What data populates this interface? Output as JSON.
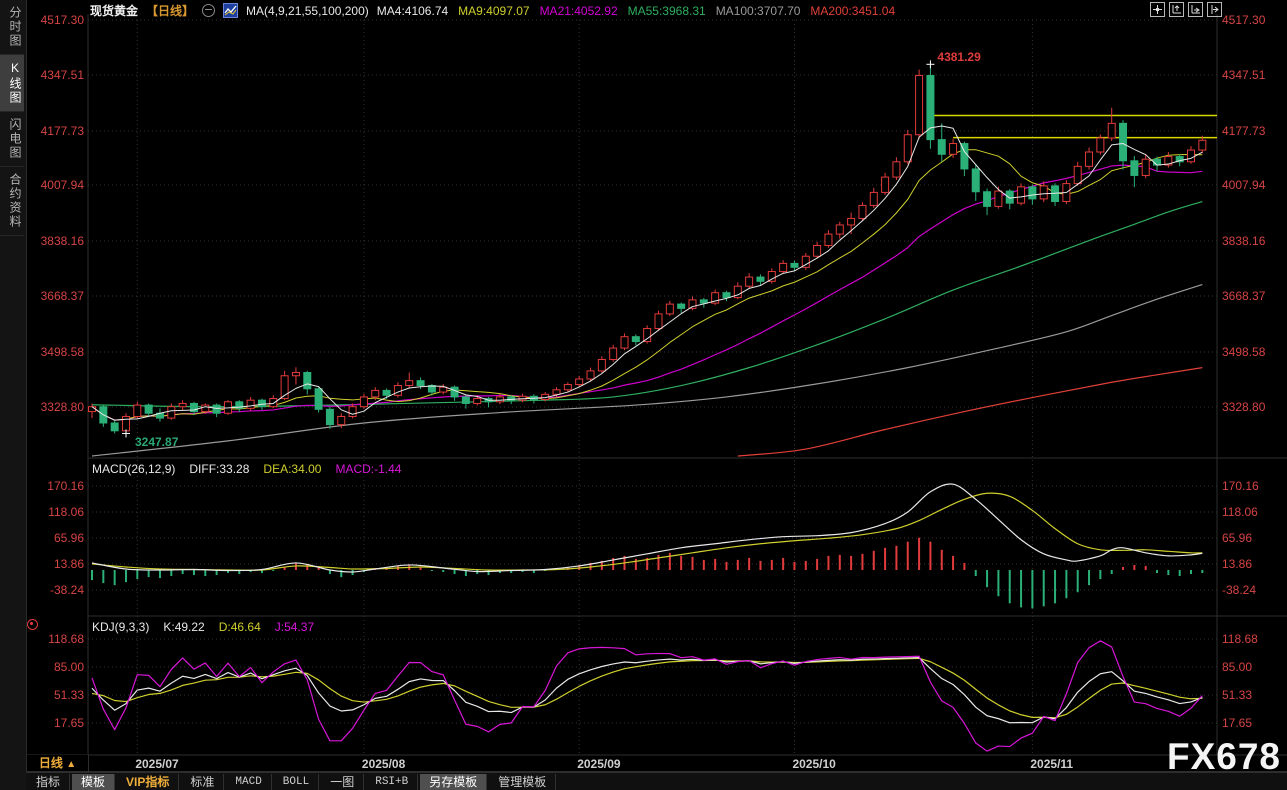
{
  "header": {
    "symbol": "现货黄金",
    "period_tag": "【日线】",
    "ma_group_label": "MA(4,9,21,55,100,200)",
    "ma_values": [
      {
        "text": "MA4:4106.74",
        "color": "#e8e8e8"
      },
      {
        "text": "MA9:4097.07",
        "color": "#cfcf2e"
      },
      {
        "text": "MA21:4052.92",
        "color": "#d400d4"
      },
      {
        "text": "MA55:3968.31",
        "color": "#2fae5f"
      },
      {
        "text": "MA100:3707.70",
        "color": "#9a9a9a"
      },
      {
        "text": "MA200:3451.04",
        "color": "#e04038"
      }
    ]
  },
  "sidebar": {
    "items": [
      {
        "label": "分时图",
        "active": false
      },
      {
        "label": "K线图",
        "active": true
      },
      {
        "label": "闪电图",
        "active": false
      },
      {
        "label": "合约资料",
        "active": false
      }
    ]
  },
  "main_axis": {
    "labels": [
      "4517.30",
      "4347.51",
      "4177.73",
      "4007.94",
      "3838.16",
      "3668.37",
      "3498.58",
      "3328.80"
    ]
  },
  "macd_panel": {
    "title": "MACD(26,12,9)",
    "values": [
      {
        "text": "DIFF:33.28",
        "color": "#e8e8e8"
      },
      {
        "text": "DEA:34.00",
        "color": "#cfcf2e"
      },
      {
        "text": "MACD:-1.44",
        "color": "#d816d8"
      }
    ],
    "axis_labels": [
      "170.16",
      "118.06",
      "65.96",
      "13.86",
      "-38.24"
    ]
  },
  "kdj_panel": {
    "title": "KDJ(9,3,3)",
    "values": [
      {
        "text": "K:49.22",
        "color": "#e8e8e8"
      },
      {
        "text": "D:46.64",
        "color": "#cfcf2e"
      },
      {
        "text": "J:54.37",
        "color": "#d816d8"
      }
    ],
    "axis_labels": [
      "118.68",
      "85.00",
      "51.33",
      "17.65"
    ]
  },
  "x_axis": {
    "labels": [
      "2025/07",
      "2025/08",
      "2025/09",
      "2025/10",
      "2025/11"
    ],
    "indices": [
      4,
      24,
      43,
      62,
      83
    ]
  },
  "annotations": {
    "high": {
      "value": "4381.29",
      "price": 4381.29,
      "index": 74
    },
    "low": {
      "value": "3247.87",
      "price": 3247.87,
      "index": 3
    }
  },
  "period_selector": {
    "label": "日线",
    "arrow": "▲"
  },
  "toolbar": {
    "items": [
      {
        "label": "指标"
      },
      {
        "label": "模板",
        "selected": true
      },
      {
        "label": "VIP指标",
        "accent": true
      },
      {
        "label": "标准"
      },
      {
        "label": "MACD",
        "mono": true
      },
      {
        "label": "BOLL",
        "mono": true
      },
      {
        "label": "一图"
      },
      {
        "label": "RSI+B",
        "mono": true
      },
      {
        "label": "另存模板",
        "selected": true
      },
      {
        "label": "管理模板"
      }
    ]
  },
  "watermark": "FX678",
  "colors": {
    "up": "#e23b3b",
    "down": "#2bb078",
    "ma4": "#e8e8e8",
    "ma9": "#cfcf2e",
    "ma21": "#cc00cc",
    "ma55": "#2fae5f",
    "ma100": "#9a9a9a",
    "ma200": "#e04038",
    "axis_text": "#d64444",
    "grid": "#333333",
    "separator": "#2e2e2e",
    "resistance": "#d8d800",
    "diff": "#e8e8e8",
    "dea": "#cfcf2e",
    "hist_up": "#e23b3b",
    "hist_down": "#2bb078",
    "k": "#e8e8e8",
    "d": "#cfcf2e",
    "j": "#d816d8",
    "high_label": "#e03c3c",
    "low_label": "#2aa876",
    "marker": "#ffffff"
  },
  "chart_data": {
    "type": "candlestick+indicators",
    "title": "现货黄金 日线",
    "price_axis_values": [
      4517.3,
      4347.51,
      4177.73,
      4007.94,
      3838.16,
      3668.37,
      3498.58,
      3328.8
    ],
    "resistance_lines": [
      {
        "price": 4224,
        "from_index": 74
      },
      {
        "price": 4156,
        "from_index": 76
      }
    ],
    "candles": [
      [
        3315,
        3340,
        3295,
        3330
      ],
      [
        3330,
        3335,
        3268,
        3280
      ],
      [
        3280,
        3290,
        3248,
        3256
      ],
      [
        3256,
        3310,
        3247.87,
        3300
      ],
      [
        3300,
        3345,
        3292,
        3335
      ],
      [
        3335,
        3340,
        3298,
        3310
      ],
      [
        3310,
        3325,
        3284,
        3295
      ],
      [
        3295,
        3340,
        3290,
        3330
      ],
      [
        3330,
        3350,
        3320,
        3340
      ],
      [
        3340,
        3345,
        3304,
        3315
      ],
      [
        3315,
        3340,
        3308,
        3335
      ],
      [
        3335,
        3340,
        3298,
        3310
      ],
      [
        3310,
        3350,
        3305,
        3345
      ],
      [
        3345,
        3350,
        3314,
        3325
      ],
      [
        3325,
        3360,
        3318,
        3350
      ],
      [
        3350,
        3355,
        3320,
        3330
      ],
      [
        3330,
        3365,
        3325,
        3355
      ],
      [
        3355,
        3440,
        3350,
        3425
      ],
      [
        3425,
        3451,
        3398,
        3435
      ],
      [
        3435,
        3440,
        3368,
        3385
      ],
      [
        3385,
        3390,
        3312,
        3322
      ],
      [
        3322,
        3330,
        3262,
        3275
      ],
      [
        3275,
        3310,
        3264,
        3300
      ],
      [
        3300,
        3340,
        3294,
        3330
      ],
      [
        3330,
        3370,
        3324,
        3360
      ],
      [
        3360,
        3390,
        3350,
        3380
      ],
      [
        3380,
        3386,
        3354,
        3365
      ],
      [
        3365,
        3405,
        3358,
        3395
      ],
      [
        3395,
        3435,
        3388,
        3410
      ],
      [
        3410,
        3420,
        3384,
        3395
      ],
      [
        3395,
        3400,
        3364,
        3375
      ],
      [
        3375,
        3400,
        3368,
        3390
      ],
      [
        3390,
        3395,
        3348,
        3360
      ],
      [
        3360,
        3365,
        3324,
        3340
      ],
      [
        3340,
        3365,
        3334,
        3355
      ],
      [
        3355,
        3360,
        3328,
        3345
      ],
      [
        3345,
        3370,
        3338,
        3360
      ],
      [
        3360,
        3366,
        3338,
        3350
      ],
      [
        3350,
        3370,
        3344,
        3362
      ],
      [
        3362,
        3368,
        3340,
        3352
      ],
      [
        3352,
        3375,
        3346,
        3368
      ],
      [
        3368,
        3390,
        3360,
        3382
      ],
      [
        3382,
        3405,
        3374,
        3398
      ],
      [
        3398,
        3425,
        3390,
        3415
      ],
      [
        3415,
        3450,
        3408,
        3440
      ],
      [
        3440,
        3485,
        3434,
        3475
      ],
      [
        3475,
        3520,
        3468,
        3510
      ],
      [
        3510,
        3555,
        3504,
        3545
      ],
      [
        3545,
        3552,
        3518,
        3530
      ],
      [
        3530,
        3580,
        3524,
        3570
      ],
      [
        3570,
        3625,
        3564,
        3615
      ],
      [
        3615,
        3655,
        3608,
        3645
      ],
      [
        3645,
        3650,
        3618,
        3632
      ],
      [
        3632,
        3668,
        3626,
        3658
      ],
      [
        3658,
        3664,
        3634,
        3648
      ],
      [
        3648,
        3690,
        3642,
        3680
      ],
      [
        3680,
        3686,
        3654,
        3665
      ],
      [
        3665,
        3712,
        3660,
        3700
      ],
      [
        3700,
        3740,
        3694,
        3728
      ],
      [
        3728,
        3736,
        3704,
        3715
      ],
      [
        3715,
        3755,
        3708,
        3745
      ],
      [
        3745,
        3780,
        3738,
        3770
      ],
      [
        3770,
        3778,
        3746,
        3758
      ],
      [
        3758,
        3802,
        3750,
        3792
      ],
      [
        3792,
        3836,
        3785,
        3825
      ],
      [
        3825,
        3872,
        3818,
        3860
      ],
      [
        3860,
        3898,
        3846,
        3888
      ],
      [
        3888,
        3926,
        3860,
        3908
      ],
      [
        3908,
        3958,
        3900,
        3948
      ],
      [
        3948,
        4002,
        3940,
        3988
      ],
      [
        3988,
        4048,
        3980,
        4035
      ],
      [
        4035,
        4096,
        4026,
        4082
      ],
      [
        4082,
        4180,
        4074,
        4165
      ],
      [
        4165,
        4365,
        4152,
        4347
      ],
      [
        4347,
        4381.29,
        4122,
        4150
      ],
      [
        4150,
        4200,
        4082,
        4105
      ],
      [
        4105,
        4152,
        4094,
        4138
      ],
      [
        4138,
        4144,
        4038,
        4060
      ],
      [
        4060,
        4072,
        3962,
        3990
      ],
      [
        3990,
        4000,
        3918,
        3945
      ],
      [
        3945,
        4006,
        3938,
        3992
      ],
      [
        3992,
        3998,
        3936,
        3955
      ],
      [
        3955,
        4016,
        3948,
        4005
      ],
      [
        4005,
        4012,
        3950,
        3968
      ],
      [
        3968,
        4022,
        3958,
        4008
      ],
      [
        4008,
        4016,
        3946,
        3960
      ],
      [
        3960,
        4026,
        3952,
        4015
      ],
      [
        4015,
        4082,
        4008,
        4068
      ],
      [
        4068,
        4126,
        4058,
        4112
      ],
      [
        4112,
        4166,
        4104,
        4155
      ],
      [
        4155,
        4248,
        4146,
        4200
      ],
      [
        4200,
        4210,
        4058,
        4085
      ],
      [
        4085,
        4100,
        4004,
        4040
      ],
      [
        4040,
        4106,
        4032,
        4090
      ],
      [
        4090,
        4098,
        4052,
        4072
      ],
      [
        4072,
        4112,
        4064,
        4098
      ],
      [
        4098,
        4106,
        4068,
        4082
      ],
      [
        4082,
        4130,
        4076,
        4118
      ],
      [
        4118,
        4162,
        4108,
        4148
      ]
    ],
    "ma_computed": [
      {
        "name": "MA21",
        "window": 21,
        "color": "#cc00cc",
        "width": 1.2
      },
      {
        "name": "MA9",
        "window": 9,
        "color": "#cfcf2e",
        "width": 1
      },
      {
        "name": "MA4",
        "window": 4,
        "color": "#e8e8e8",
        "width": 1,
        "on_top": true
      }
    ],
    "ma_drawn": [
      {
        "name": "MA200",
        "color": "#e04038",
        "points": [
          [
            57,
            3150
          ],
          [
            63,
            3200
          ],
          [
            70,
            3260
          ],
          [
            77,
            3315
          ],
          [
            84,
            3365
          ],
          [
            90,
            3405
          ],
          [
            94,
            3428
          ],
          [
            98,
            3450
          ]
        ]
      },
      {
        "name": "MA100",
        "color": "#9a9a9a",
        "points": [
          [
            0,
            3150
          ],
          [
            12,
            3225
          ],
          [
            24,
            3280
          ],
          [
            36,
            3312
          ],
          [
            48,
            3335
          ],
          [
            56,
            3360
          ],
          [
            64,
            3400
          ],
          [
            72,
            3450
          ],
          [
            80,
            3510
          ],
          [
            86,
            3560
          ],
          [
            90,
            3610
          ],
          [
            94,
            3660
          ],
          [
            98,
            3705
          ]
        ]
      },
      {
        "name": "MA55",
        "color": "#2fae5f",
        "points": [
          [
            0,
            3336
          ],
          [
            10,
            3330
          ],
          [
            20,
            3334
          ],
          [
            30,
            3342
          ],
          [
            40,
            3350
          ],
          [
            46,
            3360
          ],
          [
            52,
            3395
          ],
          [
            58,
            3450
          ],
          [
            64,
            3520
          ],
          [
            70,
            3600
          ],
          [
            76,
            3688
          ],
          [
            82,
            3762
          ],
          [
            88,
            3840
          ],
          [
            92,
            3890
          ],
          [
            95,
            3928
          ],
          [
            98,
            3960
          ]
        ]
      }
    ],
    "macd": {
      "params": [
        26,
        12,
        9
      ],
      "axis_values": [
        170.16,
        118.06,
        65.96,
        13.86,
        -38.24
      ],
      "hist": [
        -20,
        -26,
        -30,
        -24,
        -18,
        -14,
        -16,
        -12,
        -8,
        -10,
        -12,
        -10,
        -6,
        -8,
        -4,
        -6,
        -2,
        6,
        14,
        12,
        4,
        -8,
        -14,
        -10,
        -4,
        2,
        4,
        8,
        10,
        6,
        -2,
        -4,
        -8,
        -12,
        -8,
        -10,
        -6,
        -6,
        -4,
        -6,
        -2,
        2,
        6,
        10,
        14,
        18,
        24,
        28,
        22,
        24,
        30,
        34,
        28,
        26,
        20,
        22,
        16,
        20,
        24,
        18,
        20,
        24,
        16,
        18,
        22,
        28,
        30,
        28,
        32,
        38,
        44,
        48,
        56,
        64,
        56,
        40,
        28,
        14,
        -12,
        -34,
        -52,
        -66,
        -74,
        -76,
        -72,
        -66,
        -56,
        -44,
        -30,
        -18,
        -8,
        6,
        10,
        8,
        -6,
        -10,
        -12,
        -8,
        -6
      ],
      "diff_points": [
        [
          0,
          14
        ],
        [
          3,
          2
        ],
        [
          6,
          0
        ],
        [
          9,
          1
        ],
        [
          12,
          -1
        ],
        [
          15,
          1
        ],
        [
          18,
          14
        ],
        [
          21,
          0
        ],
        [
          23,
          -4
        ],
        [
          25,
          2
        ],
        [
          28,
          10
        ],
        [
          31,
          4
        ],
        [
          34,
          -3
        ],
        [
          37,
          -1
        ],
        [
          40,
          1
        ],
        [
          43,
          8
        ],
        [
          46,
          20
        ],
        [
          49,
          32
        ],
        [
          52,
          44
        ],
        [
          55,
          52
        ],
        [
          58,
          60
        ],
        [
          61,
          66
        ],
        [
          64,
          68
        ],
        [
          67,
          74
        ],
        [
          70,
          92
        ],
        [
          72,
          115
        ],
        [
          74,
          155
        ],
        [
          76,
          170
        ],
        [
          78,
          140
        ],
        [
          80,
          100
        ],
        [
          82,
          60
        ],
        [
          84,
          32
        ],
        [
          86,
          20
        ],
        [
          87,
          18
        ],
        [
          89,
          28
        ],
        [
          90,
          40
        ],
        [
          91,
          44
        ],
        [
          93,
          34
        ],
        [
          95,
          28
        ],
        [
          97,
          30
        ],
        [
          98,
          33
        ]
      ],
      "dea_points": [
        [
          0,
          12
        ],
        [
          3,
          6
        ],
        [
          6,
          2
        ],
        [
          9,
          1
        ],
        [
          12,
          0
        ],
        [
          15,
          0
        ],
        [
          18,
          8
        ],
        [
          21,
          5
        ],
        [
          23,
          2
        ],
        [
          26,
          3
        ],
        [
          29,
          6
        ],
        [
          32,
          3
        ],
        [
          35,
          0
        ],
        [
          38,
          0
        ],
        [
          41,
          1
        ],
        [
          44,
          6
        ],
        [
          47,
          14
        ],
        [
          50,
          24
        ],
        [
          53,
          34
        ],
        [
          56,
          44
        ],
        [
          59,
          52
        ],
        [
          62,
          58
        ],
        [
          65,
          63
        ],
        [
          68,
          70
        ],
        [
          71,
          82
        ],
        [
          73,
          98
        ],
        [
          75,
          120
        ],
        [
          77,
          140
        ],
        [
          79,
          152
        ],
        [
          81,
          146
        ],
        [
          83,
          118
        ],
        [
          85,
          82
        ],
        [
          87,
          52
        ],
        [
          89,
          40
        ],
        [
          91,
          39
        ],
        [
          93,
          40
        ],
        [
          95,
          37
        ],
        [
          97,
          34
        ],
        [
          98,
          34
        ]
      ]
    },
    "kdj": {
      "params": [
        9,
        3,
        3
      ],
      "axis_values": [
        118.68,
        85.0,
        51.33,
        17.65
      ]
    }
  }
}
